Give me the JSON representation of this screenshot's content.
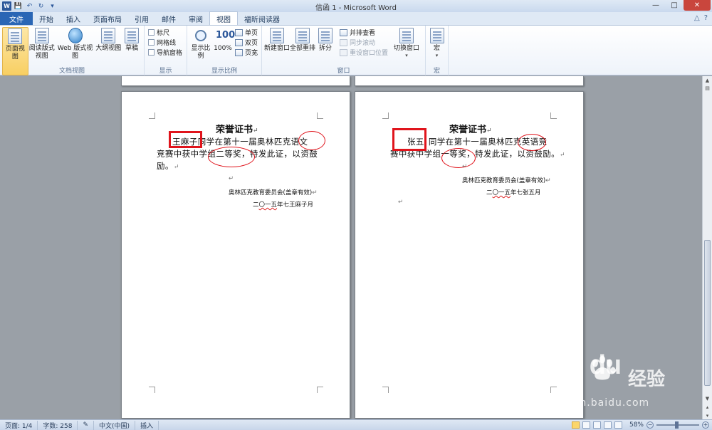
{
  "window": {
    "title": "信函 1 - Microsoft Word",
    "app_icon": "W",
    "controls": {
      "minimize": "—",
      "maximize": "□",
      "close": "✕"
    }
  },
  "qat": {
    "save": "💾",
    "undo": "↶",
    "redo": "↻",
    "customize": "▾"
  },
  "tabs": [
    {
      "label": "文件",
      "type": "file"
    },
    {
      "label": "开始"
    },
    {
      "label": "插入"
    },
    {
      "label": "页面布局"
    },
    {
      "label": "引用"
    },
    {
      "label": "邮件"
    },
    {
      "label": "审阅"
    },
    {
      "label": "视图",
      "active": true
    },
    {
      "label": "福昕阅读器"
    }
  ],
  "tabrow_right": {
    "minimize_ribbon": "△",
    "help": "?"
  },
  "ribbon": {
    "doc_views": {
      "label": "文档视图",
      "print_layout": "页面视图",
      "read_mode": "阅读版式\n视图",
      "web_layout": "Web 版式视图",
      "outline": "大纲视图",
      "draft": "草稿"
    },
    "show": {
      "label": "显示",
      "ruler": "标尺",
      "gridlines": "网格线",
      "nav_pane": "导航窗格"
    },
    "zoom": {
      "label": "显示比例",
      "zoom": "显示比例",
      "hundred": "100%",
      "hundred_icon": "100",
      "one_page": "单页",
      "two_pages": "双页",
      "page_width": "页宽"
    },
    "window": {
      "label": "窗口",
      "new_window": "新建窗口",
      "arrange_all": "全部重排",
      "split": "拆分",
      "side_by_side": "并排查看",
      "sync_scroll": "同步滚动",
      "reset_position": "重设窗口位置",
      "switch_windows": "切换窗口"
    },
    "macros": {
      "label": "宏",
      "macros": "宏"
    }
  },
  "document": {
    "page1": {
      "title": "荣誉证书",
      "name": "王麻子",
      "line1_rest": "同学在第十一届奥林匹克",
      "subject": "语文",
      "line2_a": "竞赛中获中学组",
      "award": "二等奖",
      "line2_b": "，特发此证，以资鼓",
      "line3": "励。",
      "issuer": "奥林匹克教育委员会(盖章有效)",
      "date_prefix": "二",
      "date_mid": "〇一五",
      "date_suffix": "年七王麻子月"
    },
    "page2": {
      "title": "荣誉证书",
      "name": "张五",
      "line1_rest": "同学在第十一届奥林匹克",
      "subject": "英语",
      "line1_end": "竞",
      "line2_a": "赛中获中学组",
      "award": "一等奖",
      "line2_b": "，特发此证，以资鼓励。",
      "issuer": "奥林匹克教育委员会(盖章有效)",
      "date_prefix": "二",
      "date_mid": "〇一五",
      "date_suffix": "年七张五月"
    },
    "para_mark": "↵"
  },
  "statusbar": {
    "page": "页面: 1/4",
    "words": "字数: 258",
    "language": "中文(中国)",
    "mode": "插入",
    "zoom": "58%",
    "zoom_minus": "−",
    "zoom_plus": "+"
  },
  "watermark": {
    "logo": "Bai  du",
    "cn": "经验",
    "url": "jingyan.baidu.com"
  },
  "colors": {
    "accent": "#2b579a",
    "file_tab": "#2a66b5",
    "annotation_red": "#e0141c",
    "close_button": "#c9463d"
  }
}
